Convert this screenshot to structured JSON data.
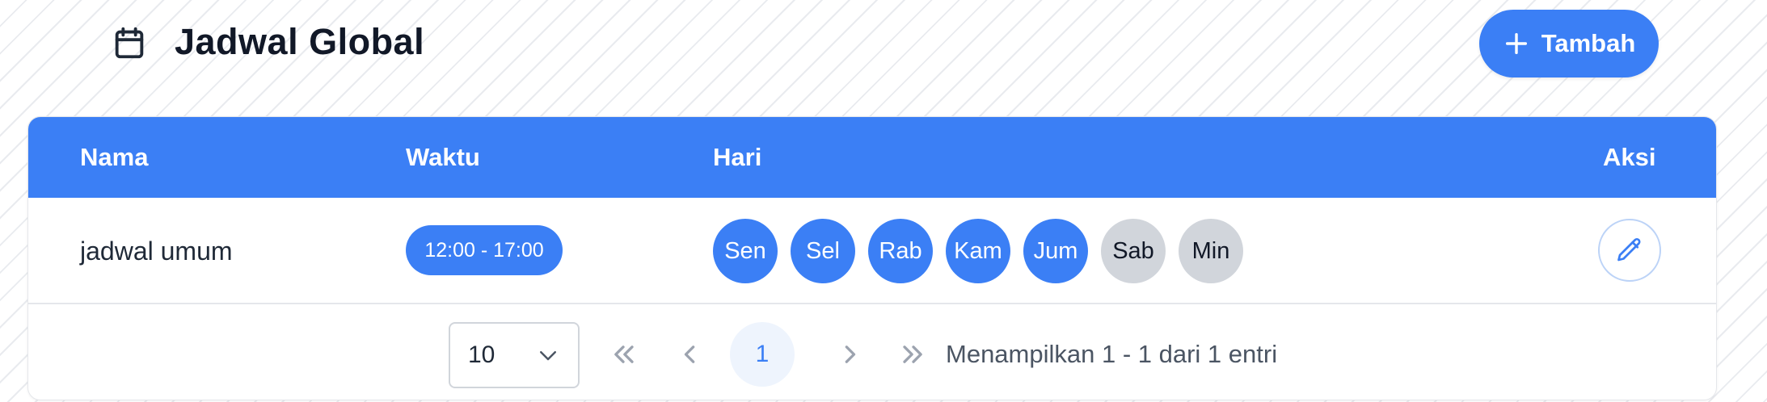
{
  "header": {
    "title": "Jadwal Global",
    "title_icon": "calendar-icon",
    "add_button_label": "Tambah",
    "add_button_icon": "plus-icon"
  },
  "table": {
    "columns": [
      "Nama",
      "Waktu",
      "Hari",
      "Aksi"
    ],
    "rows": [
      {
        "name": "jadwal umum",
        "time": "12:00 - 17:00",
        "days": [
          {
            "label": "Sen",
            "active": true
          },
          {
            "label": "Sel",
            "active": true
          },
          {
            "label": "Rab",
            "active": true
          },
          {
            "label": "Kam",
            "active": true
          },
          {
            "label": "Jum",
            "active": true
          },
          {
            "label": "Sab",
            "active": false
          },
          {
            "label": "Min",
            "active": false
          }
        ],
        "action_icon": "pencil-icon"
      }
    ]
  },
  "pagination": {
    "page_size": "10",
    "current_page": "1",
    "info": "Menampilkan 1 - 1 dari 1 entri"
  },
  "colors": {
    "accent": "#3b7ff5",
    "inactive_day": "#d1d5db"
  }
}
